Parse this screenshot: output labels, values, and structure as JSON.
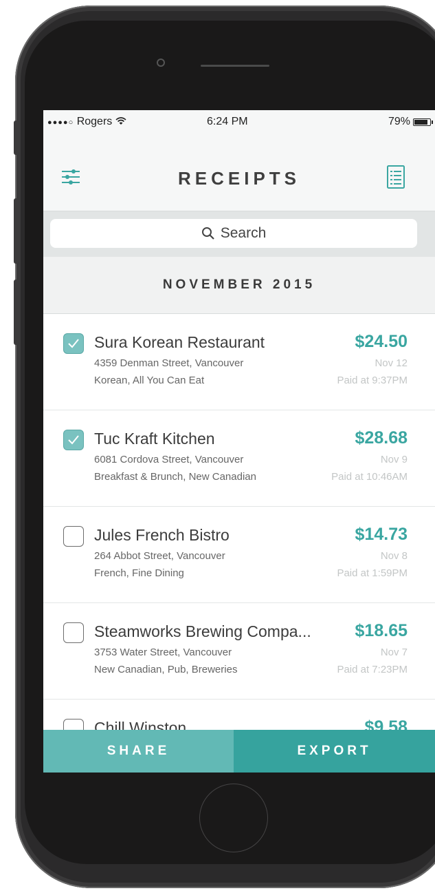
{
  "status_bar": {
    "signal": "●●●●○",
    "carrier": "Rogers",
    "time": "6:24 PM",
    "battery": "79%"
  },
  "nav": {
    "title": "RECEIPTS"
  },
  "search": {
    "placeholder": "Search"
  },
  "section": {
    "title": "NOVEMBER 2015"
  },
  "receipts": [
    {
      "name": "Sura Korean Restaurant",
      "address": "4359 Denman Street, Vancouver",
      "categories": "Korean, All You Can Eat",
      "amount": "$24.50",
      "date": "Nov 12",
      "paid": "Paid at 9:37PM",
      "checked": true
    },
    {
      "name": "Tuc Kraft Kitchen",
      "address": "6081 Cordova Street, Vancouver",
      "categories": "Breakfast & Brunch, New Canadian",
      "amount": "$28.68",
      "date": "Nov 9",
      "paid": "Paid at 10:46AM",
      "checked": true
    },
    {
      "name": "Jules French Bistro",
      "address": "264 Abbot Street, Vancouver",
      "categories": "French, Fine Dining",
      "amount": "$14.73",
      "date": "Nov 8",
      "paid": "Paid at 1:59PM",
      "checked": false
    },
    {
      "name": "Steamworks Brewing Compa...",
      "address": "3753 Water Street, Vancouver",
      "categories": "New Canadian, Pub, Breweries",
      "amount": "$18.65",
      "date": "Nov 7",
      "paid": "Paid at 7:23PM",
      "checked": false
    },
    {
      "name": "Chill Winston",
      "amount": "$9.58",
      "checked": false
    }
  ],
  "actions": {
    "share": "SHARE",
    "export": "EXPORT"
  },
  "colors": {
    "accent": "#3aa6a1",
    "share_bg": "#62b9b5",
    "export_bg": "#36a39e",
    "checked_bg": "#7ac2c0"
  },
  "icons": {
    "filter": "sliders-icon",
    "list": "list-icon",
    "search": "search-icon",
    "wifi": "wifi-icon",
    "battery": "battery-icon",
    "check": "checkmark-icon"
  }
}
